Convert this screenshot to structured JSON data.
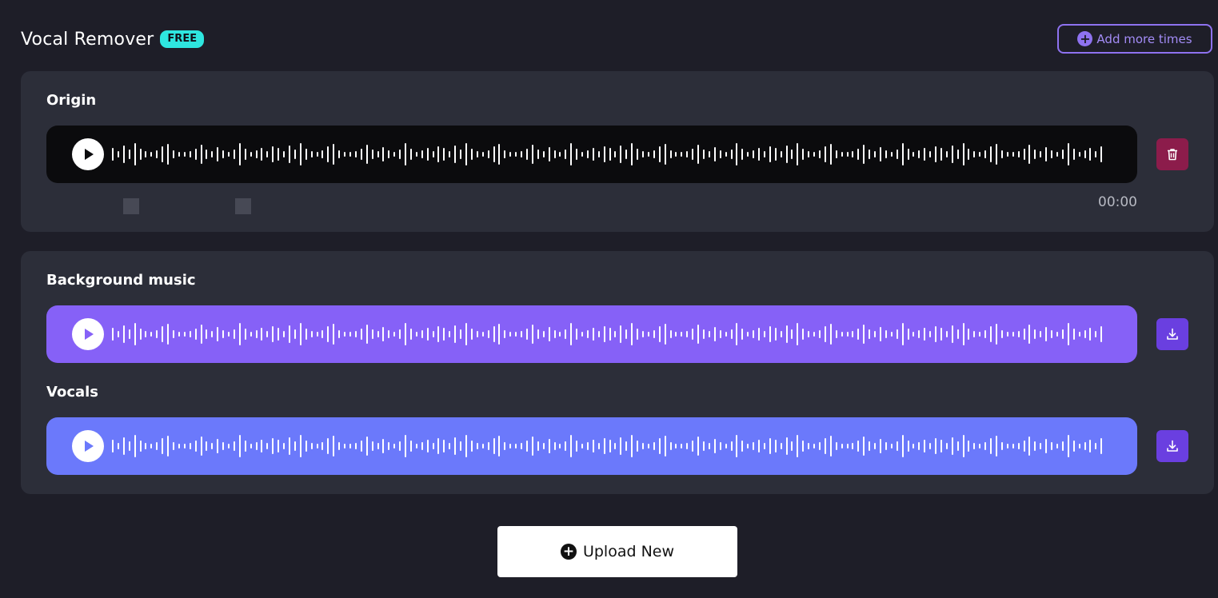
{
  "header": {
    "title": "Vocal Remover",
    "badge": "FREE"
  },
  "add_more": {
    "label": "Add more times",
    "icon": "plus-circle-icon"
  },
  "origin": {
    "label": "Origin",
    "time": "00:00",
    "action_icon": "trash-icon"
  },
  "results": {
    "background": {
      "label": "Background music",
      "action_icon": "download-icon"
    },
    "vocals": {
      "label": "Vocals",
      "action_icon": "download-icon"
    }
  },
  "upload": {
    "label": "Upload New",
    "icon": "plus-circle-icon"
  },
  "colors": {
    "page_bg": "#1e1e28",
    "card_bg": "#2c2e39",
    "badge": "#2ee6df",
    "accent": "#8e72f0",
    "origin_player": "#0b0b0d",
    "background_player": "#8661f7",
    "vocals_player": "#6b79fb",
    "delete": "#8c1c4b",
    "download": "#6a3fe0"
  }
}
